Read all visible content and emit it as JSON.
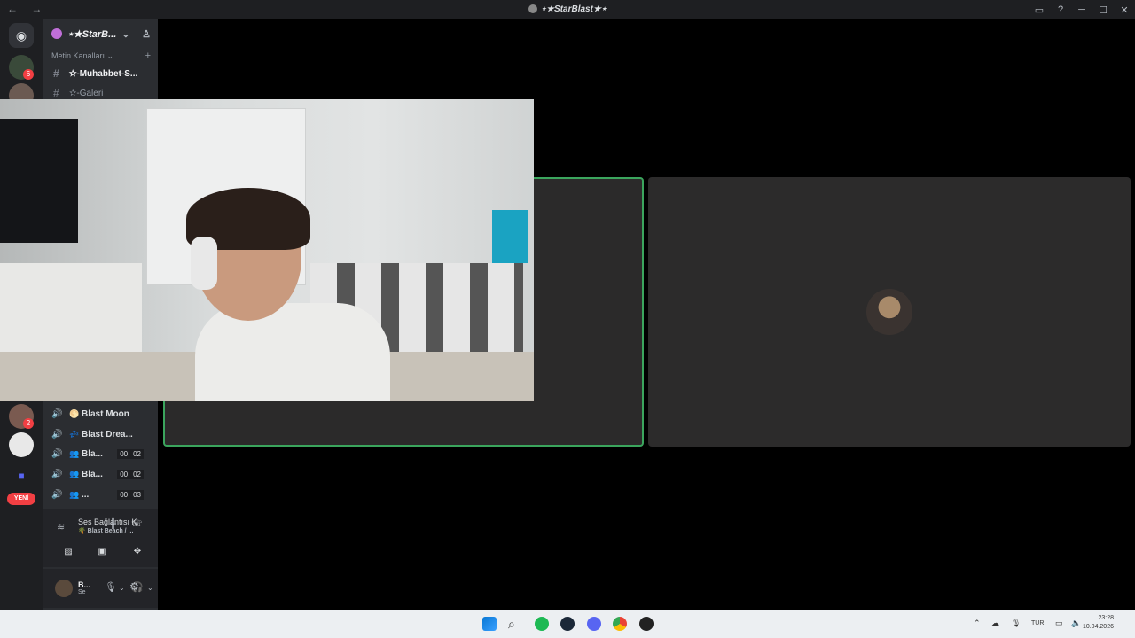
{
  "window": {
    "title": "⋆★StarBlast★⋆",
    "nav": "← →"
  },
  "servers": {
    "badge_1": "6",
    "badge_2": "2",
    "new_label": "YENİ"
  },
  "guild": {
    "name": "⋆★StarB...",
    "category": "Metin Kanalları"
  },
  "text_channels": [
    {
      "name": "✫-Muhabbet-S..."
    },
    {
      "name": "✫-Galeri"
    }
  ],
  "voice_channels": [
    {
      "emoji": "🌕",
      "name": "Blast Moon"
    },
    {
      "emoji": "💤",
      "name": "Blast Drea..."
    },
    {
      "emoji": "👥",
      "name": "Bla...",
      "count_a": "00",
      "count_b": "02"
    },
    {
      "emoji": "👥",
      "name": "Bla...",
      "count_a": "00",
      "count_b": "02"
    },
    {
      "emoji": "👥",
      "name": "...",
      "count_a": "00",
      "count_b": "03"
    }
  ],
  "voice_connection": {
    "title": "Ses Bağlantısı K",
    "subtitle": "🌴 Blast Beach / ..."
  },
  "user": {
    "name": "B...",
    "status": "Se"
  },
  "taskbar": {
    "lang": "TUR",
    "time": "23:28",
    "date": "10.04.2026"
  },
  "colors": {
    "speaking_border": "#3ba55d",
    "notification": "#f23f43",
    "discord_blurple": "#5865f2"
  }
}
